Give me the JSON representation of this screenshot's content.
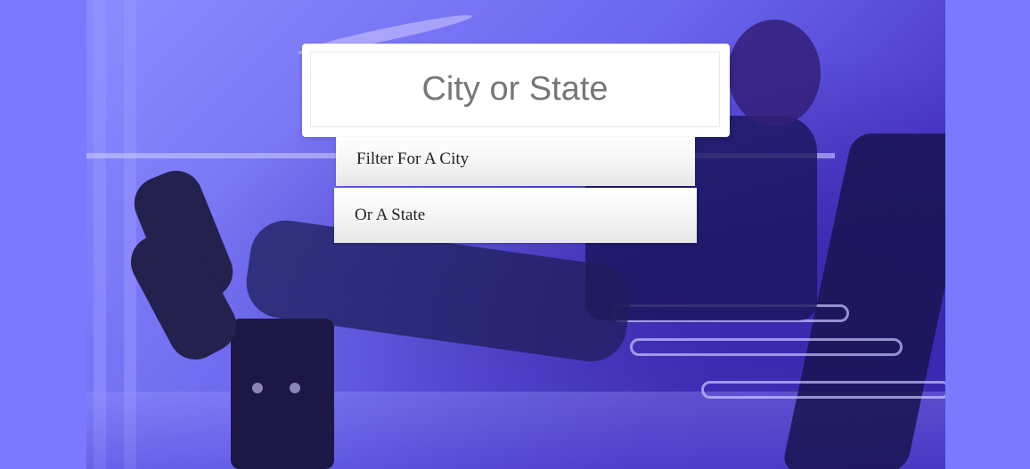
{
  "search": {
    "placeholder": "City or State"
  },
  "suggestions": [
    {
      "label": "Filter For A City"
    },
    {
      "label": "Or A State"
    }
  ],
  "colors": {
    "page_background": "#7b79ff",
    "overlay_tint": "#6b67ee"
  }
}
